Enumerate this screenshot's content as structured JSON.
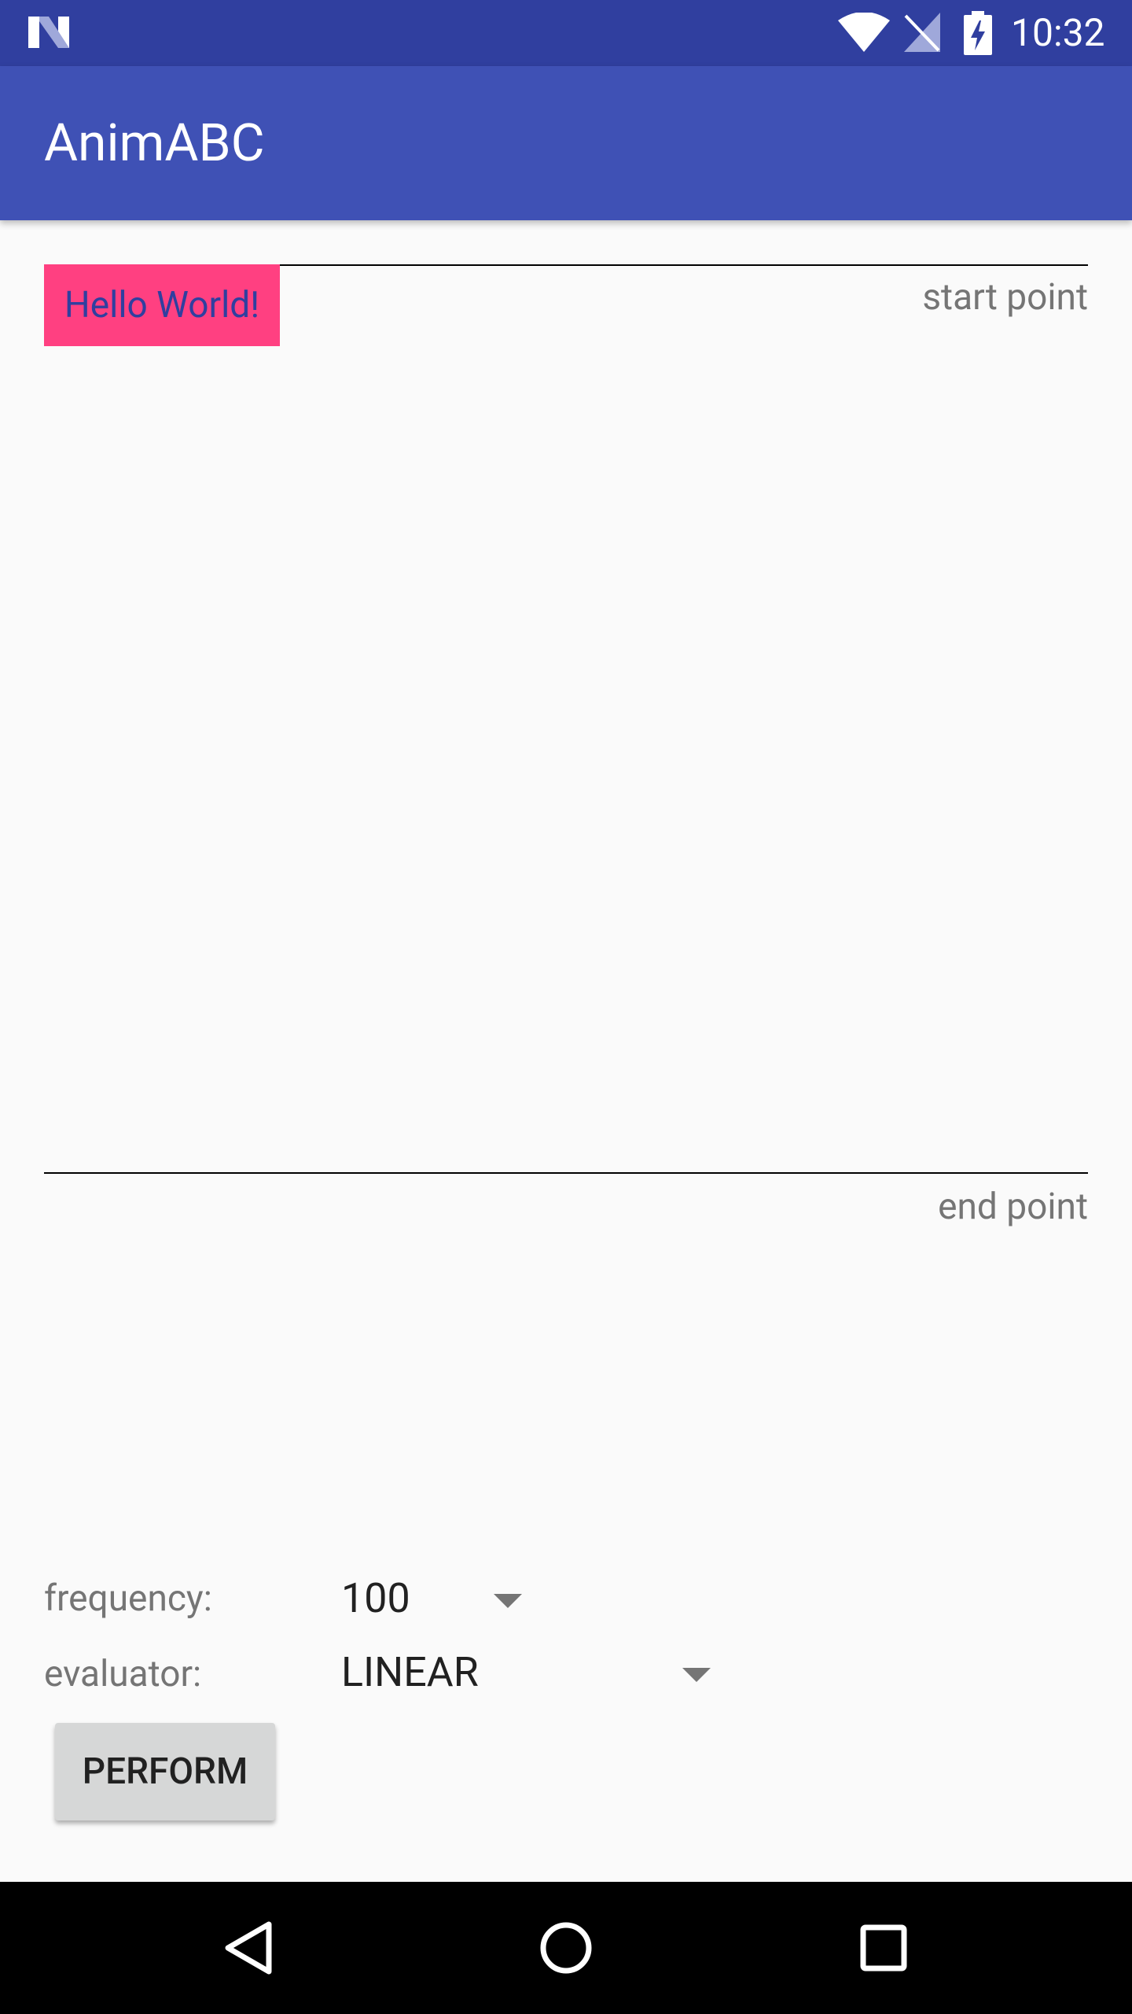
{
  "status_bar": {
    "time": "10:32",
    "icons": [
      "n-logo-icon",
      "wifi-icon",
      "no-signal-icon",
      "battery-charging-icon"
    ]
  },
  "app_bar": {
    "title": "AnimABC"
  },
  "animation_area": {
    "target_text": "Hello World!",
    "start_label": "start point",
    "end_label": "end point"
  },
  "controls": {
    "frequency_label": "frequency:",
    "frequency_value": "100",
    "evaluator_label": "evaluator:",
    "evaluator_value": "LINEAR",
    "perform_label": "PERFORM"
  },
  "nav_bar": {
    "icons": [
      "back-icon",
      "home-icon",
      "recents-icon"
    ]
  },
  "colors": {
    "status_bar": "#303f9f",
    "app_bar": "#3f51b5",
    "accent": "#ff4081",
    "background": "#fafafa"
  }
}
